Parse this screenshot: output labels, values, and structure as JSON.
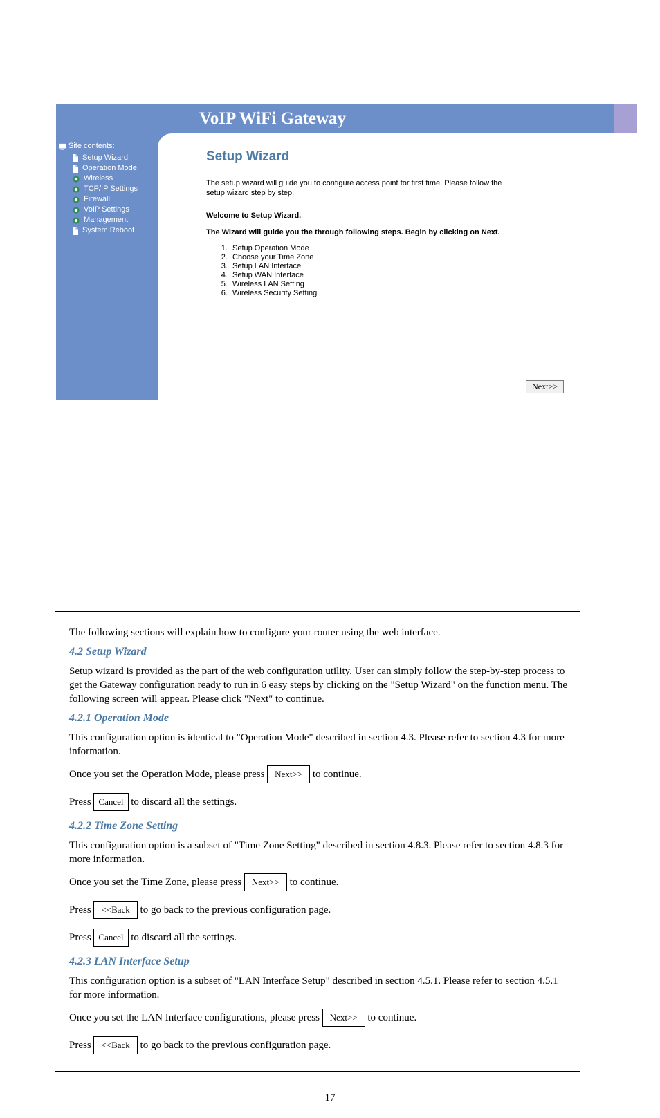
{
  "page_number": "17",
  "banner": {
    "title": "VoIP WiFi Gateway"
  },
  "sidebar": {
    "heading": "Site contents:",
    "items": [
      {
        "icon": "page",
        "label": "Setup Wizard"
      },
      {
        "icon": "page",
        "label": "Operation Mode"
      },
      {
        "icon": "folder",
        "label": "Wireless"
      },
      {
        "icon": "folder",
        "label": "TCP/IP Settings"
      },
      {
        "icon": "folder",
        "label": "Firewall"
      },
      {
        "icon": "folder",
        "label": "VoIP Settings"
      },
      {
        "icon": "folder",
        "label": "Management"
      },
      {
        "icon": "page",
        "label": "System Reboot"
      }
    ]
  },
  "main": {
    "title": "Setup Wizard",
    "intro": "The setup wizard will guide you to configure access point for first time. Please follow the setup wizard step by step.",
    "welcome": "Welcome to Setup Wizard.",
    "instruction": "The Wizard will guide you the through following steps. Begin by clicking on Next.",
    "steps": [
      "Setup Operation Mode",
      "Choose your Time Zone",
      "Setup LAN Interface",
      "Setup WAN Interface",
      "Wireless LAN Setting",
      "Wireless Security Setting"
    ],
    "next_label": "Next>>"
  },
  "doc": {
    "p1a": "The following sections will explain how to configure your router using the web interface.",
    "h_setup_wizard": "4.2 Setup Wizard",
    "p2": "Setup wizard is provided as the part of the web configuration utility. User can simply follow the step-by-step process to get the Gateway configuration ready to run in 6 easy steps by clicking on the \"Setup Wizard\" on the function menu. The following screen will appear. Please click \"Next\" to continue.",
    "h_op_mode": "4.2.1 Operation Mode",
    "p3": "This configuration option is identical to \"Operation Mode\" described in section 4.3. Please refer to section 4.3 for more information.",
    "p4_prefix": "Once you set the Operation Mode, please press ",
    "p4_btn": "Next>>",
    "p4_suffix": " to continue.",
    "p5_prefix": "Press ",
    "p5_btn": "Cancel",
    "p5_suffix": " to discard all the settings.",
    "h_tz": "4.2.2 Time Zone Setting",
    "p6": "This configuration option is a subset of \"Time Zone Setting\" described in section 4.8.3. Please refer to section 4.8.3 for more information.",
    "p7_prefix": "Once you set the Time Zone, please press ",
    "p7_btn": "Next>>",
    "p7_suffix": " to continue.",
    "p8_prefix": "Press ",
    "p8_btn": "<<Back",
    "p8_suffix": " to go back to the previous configuration page.",
    "p9_prefix": "Press ",
    "p9_btn": "Cancel",
    "p9_suffix": " to discard all the settings.",
    "h_lan": "4.2.3 LAN Interface Setup",
    "p10": "This configuration option is a subset of \"LAN Interface Setup\" described in section 4.5.1. Please refer to section 4.5.1 for more information.",
    "p11_prefix": "Once you set the LAN Interface configurations, please press ",
    "p11_btn": "Next>>",
    "p11_suffix": " to continue.",
    "p12_prefix": "Press ",
    "p12_btn": "<<Back",
    "p12_suffix": " to go back to the previous configuration page."
  }
}
